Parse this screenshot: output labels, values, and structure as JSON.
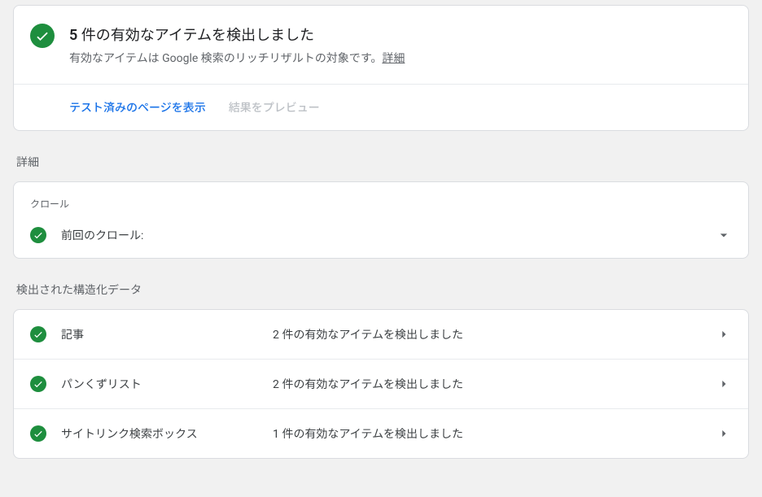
{
  "summary": {
    "count": "5",
    "title_suffix": " 件の有効なアイテムを検出しました",
    "subtitle_prefix": "有効なアイテムは Google 検索のリッチリザルトの対象です。",
    "learn_more": "詳細"
  },
  "actions": {
    "view_tested": "テスト済みのページを表示",
    "preview_results": "結果をプレビュー"
  },
  "details_label": "詳細",
  "crawl": {
    "section_label": "クロール",
    "last_crawl_label": "前回のクロール:"
  },
  "structured_data": {
    "section_label": "検出された構造化データ",
    "items": [
      {
        "name": "記事",
        "status": "2 件の有効なアイテムを検出しました"
      },
      {
        "name": "パンくずリスト",
        "status": "2 件の有効なアイテムを検出しました"
      },
      {
        "name": "サイトリンク検索ボックス",
        "status": "1 件の有効なアイテムを検出しました"
      }
    ]
  }
}
